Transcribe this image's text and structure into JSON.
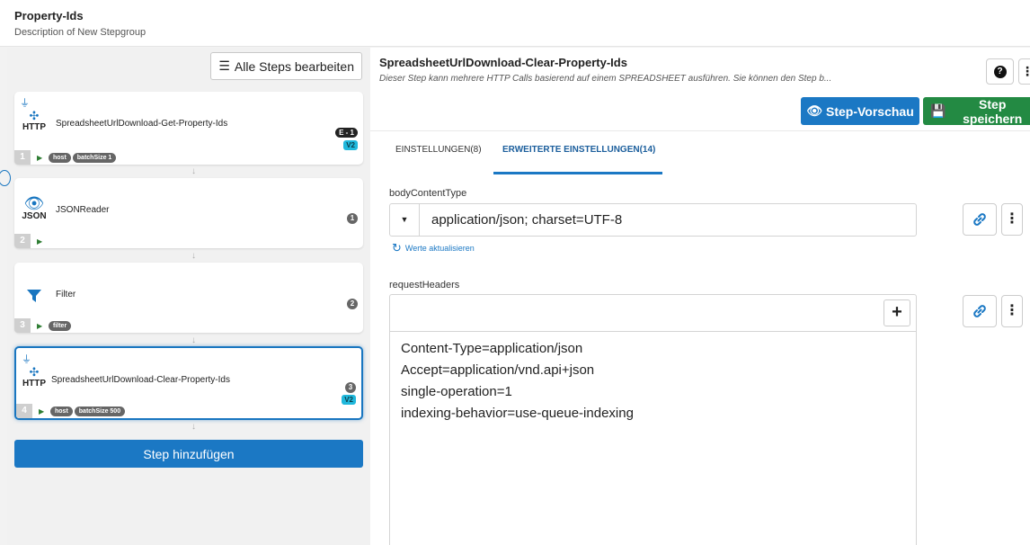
{
  "header": {
    "title": "Property-Ids",
    "description": "Description of New Stepgroup"
  },
  "sidebar": {
    "edit_all_label": "Alle Steps bearbeiten",
    "add_step_label": "Step hinzufügen",
    "steps": [
      {
        "number": "1",
        "name": "SpreadsheetUrlDownload-Get-Property-Ids",
        "icon_text": "HTTP",
        "icon": "http-icon",
        "badge_e": "E - 1",
        "badge_v": "V2",
        "tags": [
          "host",
          "batchSize 1"
        ]
      },
      {
        "number": "2",
        "name": "JSONReader",
        "icon_text": "JSON",
        "icon": "eye-icon",
        "count": "1",
        "tags": []
      },
      {
        "number": "3",
        "name": "Filter",
        "icon": "filter-icon",
        "count": "2",
        "tags": [
          "filter"
        ]
      },
      {
        "number": "4",
        "name": "SpreadsheetUrlDownload-Clear-Property-Ids",
        "icon_text": "HTTP",
        "icon": "http-icon",
        "count": "3",
        "badge_v": "V2",
        "tags": [
          "host",
          "batchSize 500"
        ]
      }
    ]
  },
  "main": {
    "title": "SpreadsheetUrlDownload-Clear-Property-Ids",
    "description": "Dieser Step kann mehrere HTTP Calls basierend auf einem SPREADSHEET ausführen. Sie können den Step b...",
    "preview_label": "Step-Vorschau",
    "save_label": "Step speichern",
    "tabs": [
      {
        "label": "EINSTELLUNGEN(8)"
      },
      {
        "label": "ERWEITERTE EINSTELLUNGEN(14)"
      }
    ],
    "body_content_type": {
      "label": "bodyContentType",
      "value": "application/json; charset=UTF-8",
      "refresh_label": "Werte aktualisieren"
    },
    "request_headers": {
      "label": "requestHeaders",
      "lines": [
        "Content-Type=application/json",
        "Accept=application/vnd.api+json",
        "single-operation=1",
        "indexing-behavior=use-queue-indexing"
      ]
    }
  },
  "colors": {
    "primary": "#1b78c4",
    "success": "#238a43",
    "badge_v2": "#20b8dc"
  }
}
